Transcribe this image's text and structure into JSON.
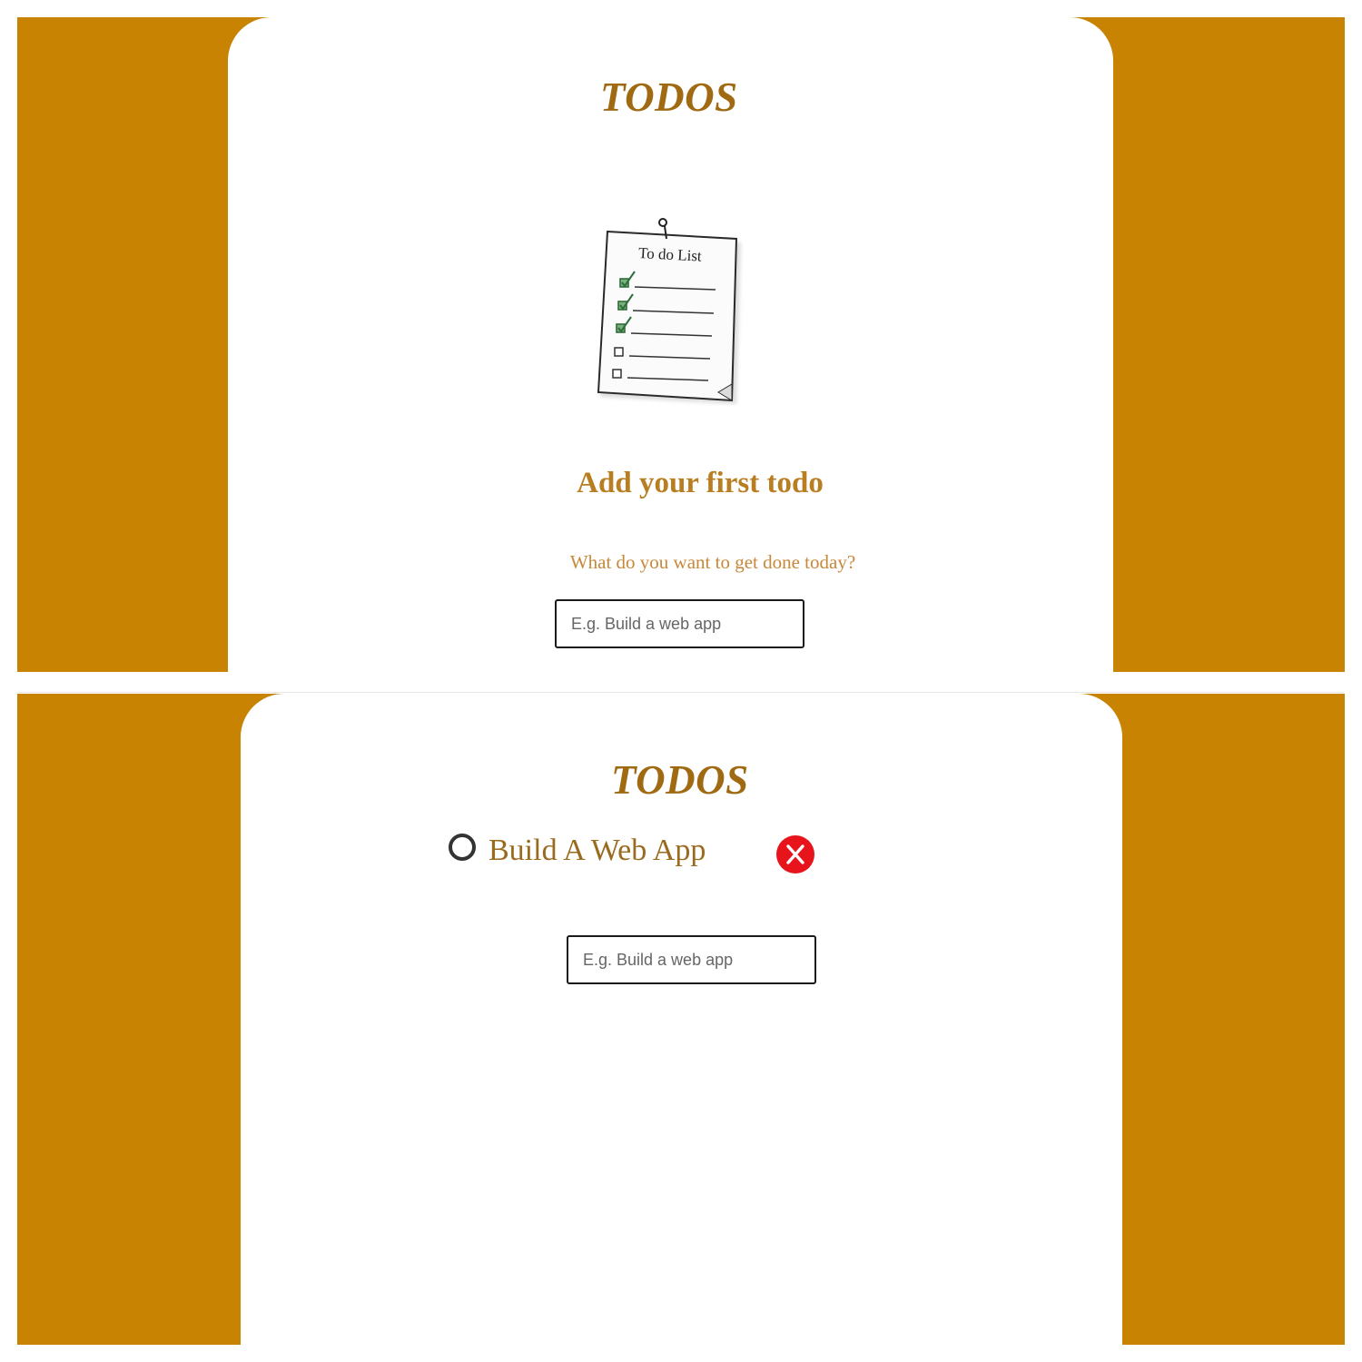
{
  "colors": {
    "background": "#c88303",
    "card": "#ffffff",
    "brand_text": "#a06a12",
    "heading_text": "#b97e22",
    "todo_text": "#9a6a1e",
    "delete_button": "#e8141c"
  },
  "screens": [
    {
      "brand": "TODOS",
      "illustration": {
        "icon": "todo-list-notepad-illustration",
        "label": "To do List"
      },
      "empty_state": {
        "heading": "Add your first todo",
        "subtitle": "What do you want to get done today?"
      },
      "input": {
        "placeholder": "E.g. Build a web app",
        "value": ""
      }
    },
    {
      "brand": "TODOS",
      "todos": [
        {
          "text": "Build A Web App",
          "completed": false,
          "check_icon": "circle-outline-icon",
          "delete_icon": "close-x-icon"
        }
      ],
      "input": {
        "placeholder": "E.g. Build a web app",
        "value": ""
      }
    }
  ]
}
